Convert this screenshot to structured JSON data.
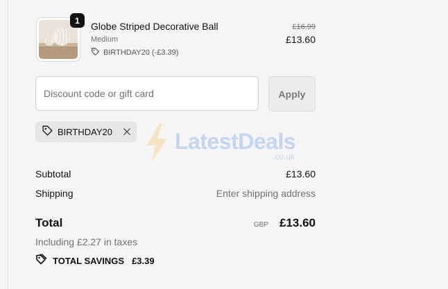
{
  "product": {
    "quantity": "1",
    "name": "Globe Striped Decorative Ball",
    "variant": "Medium",
    "discount_line": "BIRTHDAY20 (-£3.39)",
    "price_original": "£16.99",
    "price_final": "£13.60",
    "icons": {
      "discount": "tag-icon"
    }
  },
  "discount_field": {
    "placeholder": "Discount code or gift card",
    "value": "",
    "apply_label": "Apply"
  },
  "applied_code": {
    "code": "BIRTHDAY20",
    "icons": {
      "tag": "tag-icon",
      "remove": "close-icon"
    }
  },
  "watermark": {
    "text": "LatestDeals",
    "subtext": ".co.uk"
  },
  "summary": {
    "subtotal_label": "Subtotal",
    "subtotal_value": "£13.60",
    "shipping_label": "Shipping",
    "shipping_value": "Enter shipping address",
    "total_label": "Total",
    "currency": "GBP",
    "total_value": "£13.60",
    "taxes_note": "Including £2.27 in taxes",
    "savings_label": "TOTAL SAVINGS",
    "savings_value": "£3.39"
  },
  "colors": {
    "background": "#f5f5f5",
    "text": "#111111",
    "muted": "#707070",
    "chip_background": "#e6e6e6",
    "watermark_blue": "#4a86e8",
    "watermark_bolt": "#f5b640"
  }
}
